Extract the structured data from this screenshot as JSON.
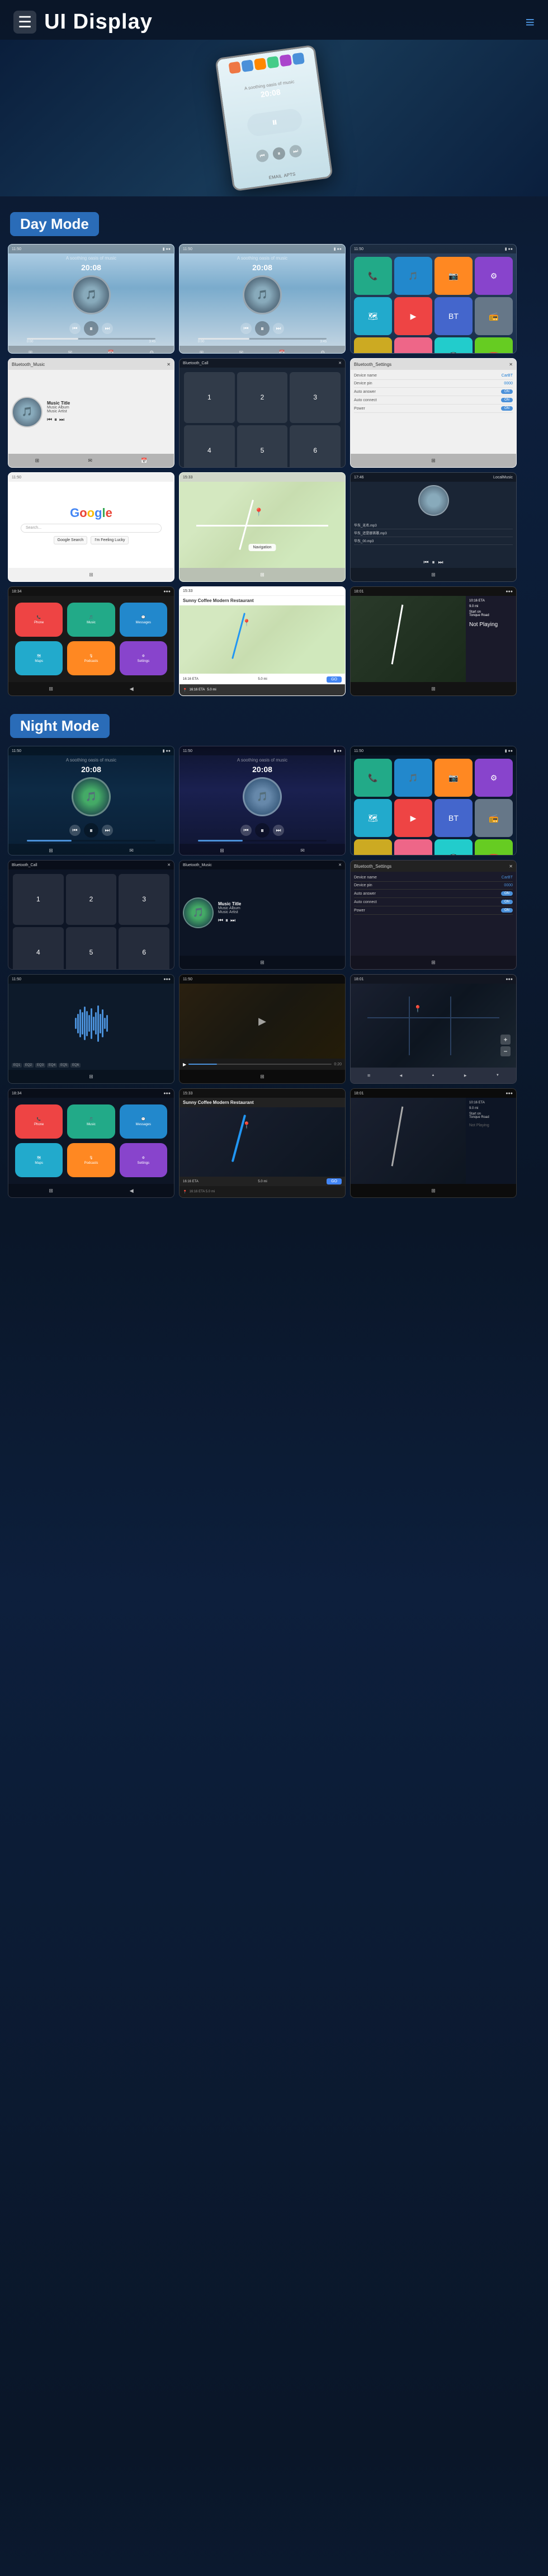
{
  "header": {
    "title": "UI Display",
    "menu_icon": "☰",
    "more_icon": "≡"
  },
  "sections": {
    "day_mode": {
      "label": "Day Mode",
      "screens": [
        {
          "id": "day-music-1",
          "type": "music",
          "time": "20:08",
          "subtitle": "A soothing oasis of music",
          "has_album": true
        },
        {
          "id": "day-music-2",
          "type": "music",
          "time": "20:08",
          "subtitle": "A soothing oasis of music",
          "has_album": true
        },
        {
          "id": "day-apps",
          "type": "apps",
          "has_bt": true
        },
        {
          "id": "day-bt-music",
          "type": "bluetooth_music",
          "label": "Bluetooth_Music",
          "track": "Music Title",
          "album": "Music Album",
          "artist": "Music Artist"
        },
        {
          "id": "day-bt-call",
          "type": "bluetooth_call",
          "label": "Bluetooth_Call"
        },
        {
          "id": "day-bt-settings",
          "type": "bluetooth_settings",
          "label": "Bluetooth_Settings",
          "device_name": "CarBT",
          "device_pin": "0000",
          "auto_answer": true,
          "auto_connect": true,
          "power": true
        },
        {
          "id": "day-google",
          "type": "google"
        },
        {
          "id": "day-map",
          "type": "map"
        },
        {
          "id": "day-local-music",
          "type": "local_music",
          "label": "LocalMusic"
        },
        {
          "id": "day-carplay-home",
          "type": "carplay_home"
        },
        {
          "id": "day-carplay-nav",
          "type": "carplay_nav",
          "restaurant": "Sunny Coffee Modern Restaurant",
          "eta": "16:16 ETA",
          "distance": "5.0 mi"
        },
        {
          "id": "day-carplay-turn",
          "type": "carplay_turn",
          "street": "Tonque Road",
          "distance": "9.0 mi",
          "arrival": "10:16 ETA"
        }
      ]
    },
    "night_mode": {
      "label": "Night Mode",
      "screens": [
        {
          "id": "night-music-1",
          "type": "music_night",
          "time": "20:08"
        },
        {
          "id": "night-music-2",
          "type": "music_night2",
          "time": "20:08"
        },
        {
          "id": "night-apps",
          "type": "apps_night"
        },
        {
          "id": "night-bt-call",
          "type": "bluetooth_call_night",
          "label": "Bluetooth_Call"
        },
        {
          "id": "night-bt-music",
          "type": "bluetooth_music_night",
          "label": "Bluetooth_Music",
          "track": "Music Title",
          "album": "Music Album",
          "artist": "Music Artist"
        },
        {
          "id": "night-bt-settings",
          "type": "bluetooth_settings_night",
          "label": "Bluetooth_Settings"
        },
        {
          "id": "night-wave",
          "type": "waveform_night"
        },
        {
          "id": "night-video",
          "type": "video_night"
        },
        {
          "id": "night-map-dark",
          "type": "map_dark"
        },
        {
          "id": "night-carplay-home",
          "type": "carplay_home_night"
        },
        {
          "id": "night-carplay-nav",
          "type": "carplay_nav_night",
          "restaurant": "Sunny Coffee Modern Restaurant"
        },
        {
          "id": "night-carplay-turn",
          "type": "carplay_turn_night"
        }
      ]
    }
  },
  "music": {
    "track": "Music Title",
    "album": "Music Album",
    "artist": "Music Artist",
    "time_current": "0:00",
    "time_total": "3:45"
  },
  "bluetooth": {
    "device_name_label": "Device name",
    "device_name_value": "CarBT",
    "device_pin_label": "Device pin",
    "device_pin_value": "0000",
    "auto_answer_label": "Auto answer",
    "auto_connect_label": "Auto connect",
    "power_label": "Power"
  },
  "navigation": {
    "restaurant_name": "Sunny Coffee Modern Restaurant",
    "eta_label": "16:16 ETA",
    "distance": "5.0 mi",
    "go_button": "GO",
    "turn_street": "Tonque Road",
    "start_label": "Start on",
    "not_playing": "Not Playing"
  },
  "local_music": {
    "files": [
      "华东_无名.mp3",
      "华东_还是那首歌.mp3",
      "华东_00.mp3"
    ]
  },
  "statusbar": {
    "time_left": "11:50",
    "time_right": "17:46",
    "signal": "●●●",
    "battery": "▮▮▮"
  }
}
